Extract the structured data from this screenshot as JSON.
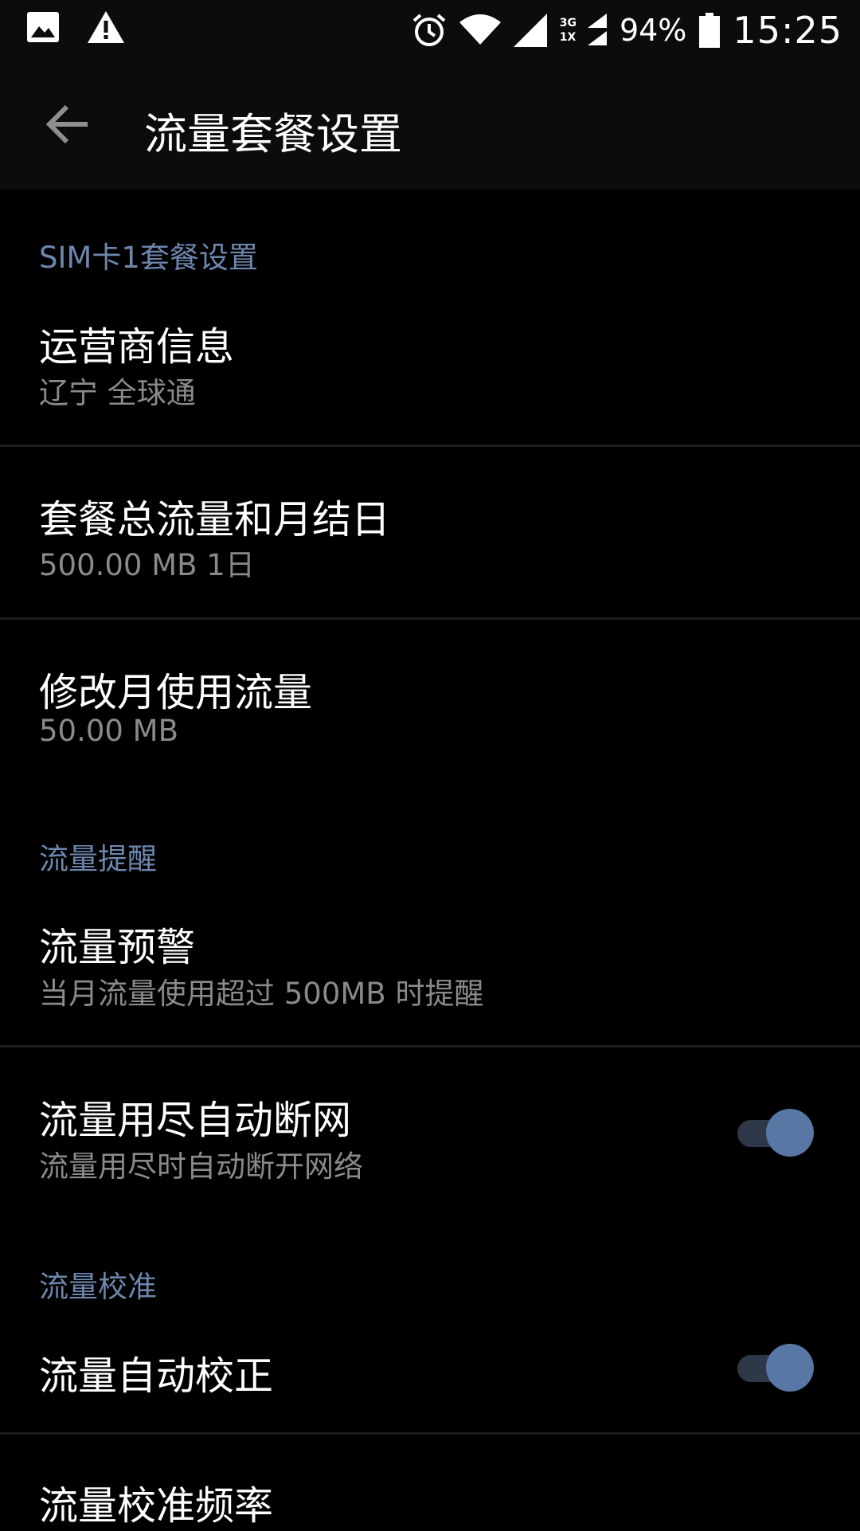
{
  "status_bar": {
    "battery_percent": "94%",
    "time": "15:25",
    "network_top": "3G",
    "network_bottom": "1X",
    "icons": [
      "image-icon",
      "warning-icon",
      "alarm-icon",
      "wifi-icon",
      "signal-icon",
      "signal-icon",
      "battery-icon"
    ]
  },
  "app_bar": {
    "title": "流量套餐设置",
    "back_icon": "arrow-left-icon"
  },
  "sections": {
    "sim1": {
      "header": "SIM卡1套餐设置",
      "carrier": {
        "title": "运营商信息",
        "subtitle": "辽宁 全球通"
      },
      "plan": {
        "title": "套餐总流量和月结日",
        "subtitle": "500.00 MB 1日"
      },
      "usage": {
        "title": "修改月使用流量",
        "subtitle": "50.00 MB"
      }
    },
    "reminder": {
      "header": "流量提醒",
      "warning": {
        "title": "流量预警",
        "subtitle": "当月流量使用超过 500MB 时提醒"
      },
      "auto_disconnect": {
        "title": "流量用尽自动断网",
        "subtitle": "流量用尽时自动断开网络",
        "enabled": true
      }
    },
    "calibration": {
      "header": "流量校准",
      "auto_calibrate": {
        "title": "流量自动校正",
        "enabled": true
      },
      "frequency": {
        "title": "流量校准频率"
      }
    }
  },
  "colors": {
    "accent": "#6c86ad",
    "toggle_thumb": "#5877a4",
    "toggle_track": "#2f3848",
    "background": "#000000",
    "appbar": "#0c0c0c"
  }
}
